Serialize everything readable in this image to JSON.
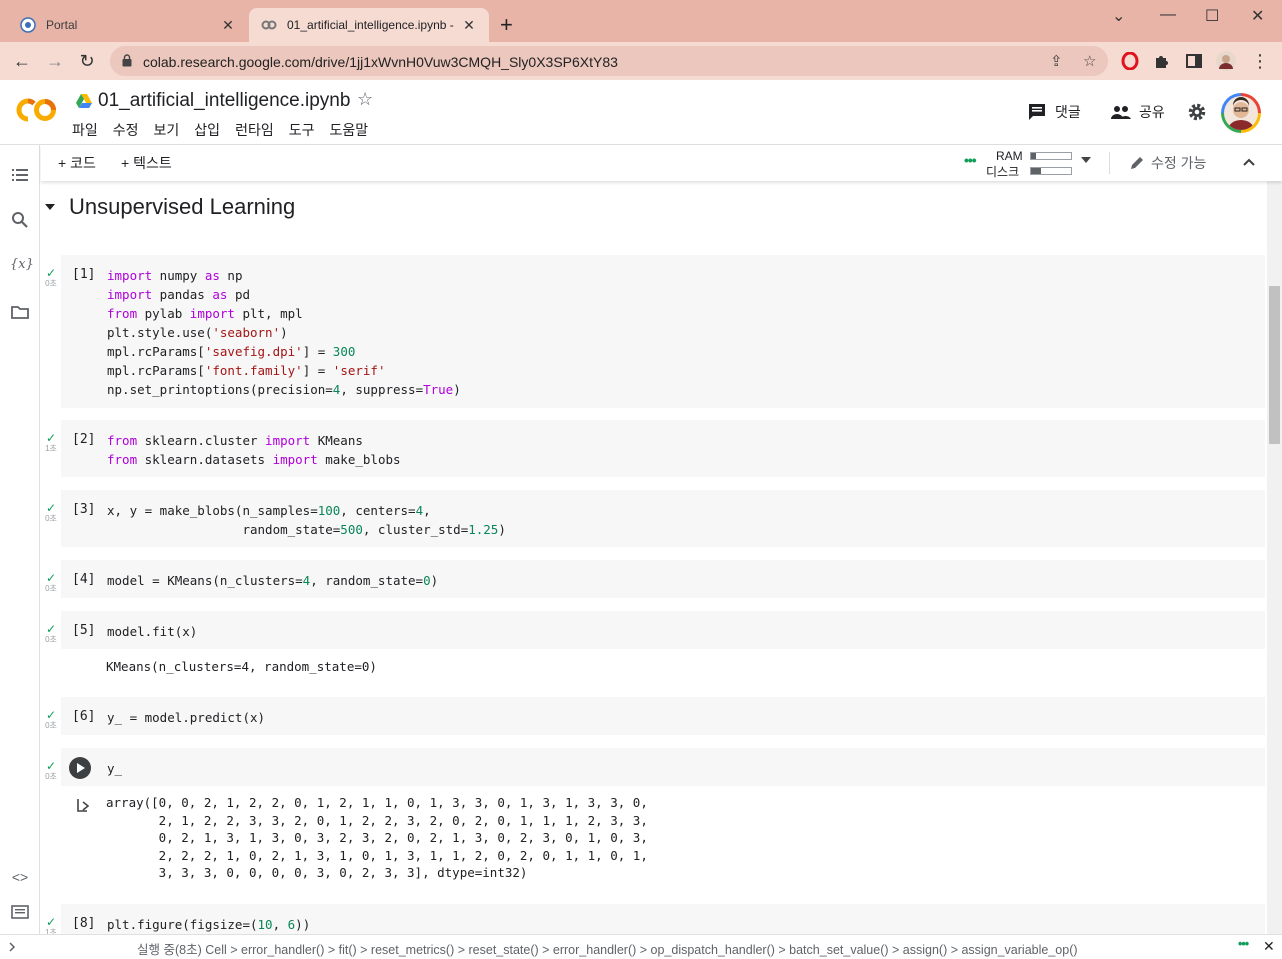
{
  "browser": {
    "tabs": [
      {
        "title": "Portal",
        "active": false
      },
      {
        "title": "01_artificial_intelligence.ipynb -",
        "active": true
      }
    ],
    "url": "colab.research.google.com/drive/1jj1xWvnH0Vuw3CMQH_Sly0X3SP6XtY83"
  },
  "header": {
    "notebook_title": "01_artificial_intelligence.ipynb",
    "menu": [
      "파일",
      "수정",
      "보기",
      "삽입",
      "런타임",
      "도구",
      "도움말"
    ],
    "comment_label": "댓글",
    "share_label": "공유"
  },
  "toolbar": {
    "add_code": "+ 코드",
    "add_text": "+ 텍스트",
    "ram_label": "RAM",
    "disk_label": "디스크",
    "ram_usage": 0.12,
    "disk_usage": 0.25,
    "editable_label": "수정 가능"
  },
  "section": {
    "title": "Unsupervised Learning"
  },
  "cells": [
    {
      "prompt": "[1]",
      "time": "0초"
    },
    {
      "prompt": "[2]",
      "time": "1초"
    },
    {
      "prompt": "[3]",
      "time": "0초"
    },
    {
      "prompt": "[4]",
      "time": "0초"
    },
    {
      "prompt": "[5]",
      "time": "0초",
      "output": "KMeans(n_clusters=4, random_state=0)"
    },
    {
      "prompt": "[6]",
      "time": "0초"
    },
    {
      "prompt": "",
      "time": "0초",
      "output": "array([0, 0, 2, 1, 2, 2, 0, 1, 2, 1, 1, 0, 1, 3, 3, 0, 1, 3, 1, 3, 3, 0,\n       2, 1, 2, 2, 3, 3, 2, 0, 1, 2, 2, 3, 2, 0, 2, 0, 1, 1, 1, 2, 3, 3,\n       0, 2, 1, 3, 1, 3, 0, 3, 2, 3, 2, 0, 2, 1, 3, 0, 2, 3, 0, 1, 0, 3,\n       2, 2, 2, 1, 0, 2, 1, 3, 1, 0, 1, 3, 1, 1, 2, 0, 2, 0, 1, 1, 0, 1,\n       3, 3, 3, 0, 0, 0, 0, 3, 0, 2, 3, 3], dtype=int32)"
    },
    {
      "prompt": "[8]",
      "time": "1초"
    }
  ],
  "statusbar": {
    "text": "실행 중(8초) Cell > error_handler() > fit() > reset_metrics() > reset_state() > error_handler() > op_dispatch_handler() > batch_set_value() > assign() > assign_variable_op()"
  }
}
